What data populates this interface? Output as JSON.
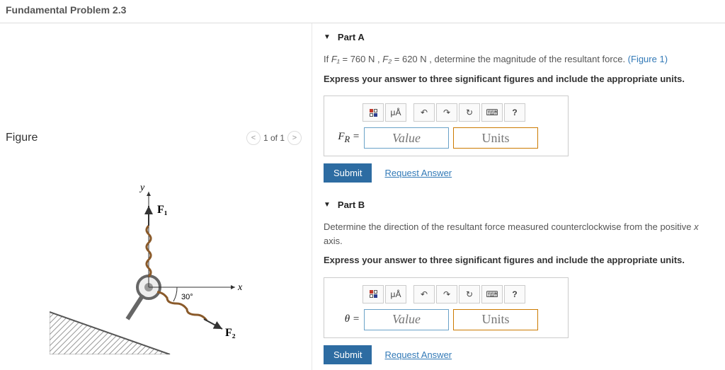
{
  "header": {
    "title": "Fundamental Problem 2.3"
  },
  "figure": {
    "title": "Figure",
    "pager": {
      "label": "1 of 1"
    },
    "labels": {
      "y": "y",
      "x": "x",
      "F1": "F₁",
      "F2": "F₂",
      "angle": "30°"
    }
  },
  "partA": {
    "title": "Part A",
    "prompt_prefix": "If ",
    "f1_label": "F₁",
    "f1_value": " = 760 N",
    "sep": " , ",
    "f2_label": "F₂",
    "f2_value": " = 620 N",
    "prompt_rest": " , determine the magnitude of the resultant force. ",
    "fig_link": "(Figure 1)",
    "instructions": "Express your answer to three significant figures and include the appropriate units.",
    "toolbar": {
      "mu": "μÅ",
      "undo": "↶",
      "redo": "↷",
      "reset": "↻",
      "keyboard": "⌨",
      "help": "?"
    },
    "var_label": "F_R =",
    "value_placeholder": "Value",
    "units_placeholder": "Units",
    "submit": "Submit",
    "request": "Request Answer"
  },
  "partB": {
    "title": "Part B",
    "prompt": "Determine the direction of the resultant force measured counterclockwise from the positive x axis.",
    "instructions": "Express your answer to three significant figures and include the appropriate units.",
    "toolbar": {
      "mu": "μÅ",
      "undo": "↶",
      "redo": "↷",
      "reset": "↻",
      "keyboard": "⌨",
      "help": "?"
    },
    "var_label": "θ =",
    "value_placeholder": "Value",
    "units_placeholder": "Units",
    "submit": "Submit",
    "request": "Request Answer"
  }
}
